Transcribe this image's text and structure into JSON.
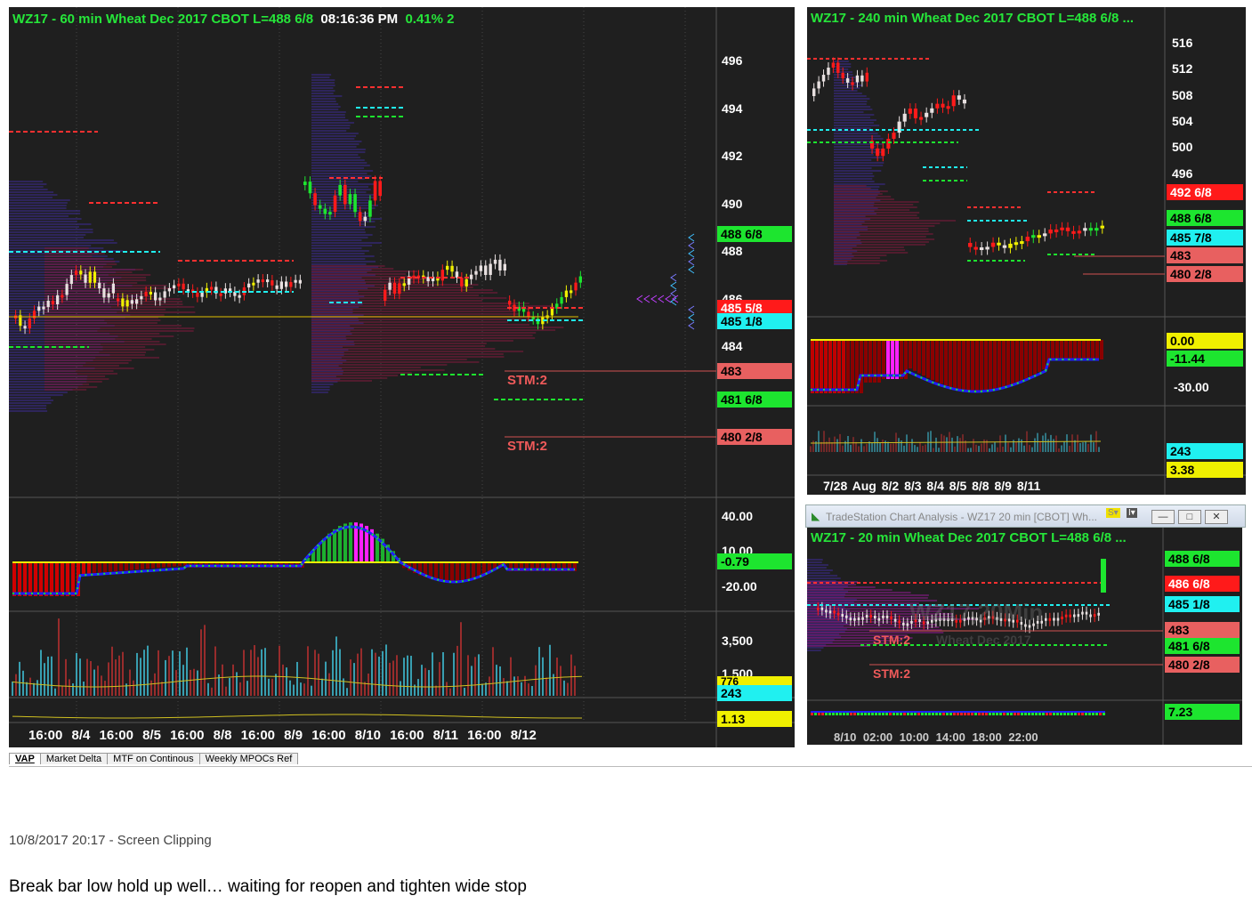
{
  "left": {
    "title": {
      "symbol": "WZ17 - 60 min  Wheat Dec 2017  CBOT  L=488 6/8",
      "time": "08:16:36 PM",
      "tail": "0.41%  2"
    },
    "price_axis": [
      "496",
      "494",
      "492",
      "490",
      "488",
      "486",
      "484"
    ],
    "tags": [
      {
        "text": "488 6/8",
        "color": "#1de52f"
      },
      {
        "text": "485 5/8",
        "color": "#ff1a1a"
      },
      {
        "text": "485 1/8",
        "color": "#20f0f0"
      },
      {
        "text": "483",
        "color": "#e86060"
      },
      {
        "text": "481 6/8",
        "color": "#1de52f"
      },
      {
        "text": "480 2/8",
        "color": "#e86060"
      }
    ],
    "stm1": "STM:2",
    "stm2": "STM:2",
    "osc_axis": [
      "40.00",
      "10.00",
      "-20.00"
    ],
    "osc_tag": "-0.79",
    "vol_axis": [
      "3,500",
      "1,500"
    ],
    "vol_tags": [
      "776",
      "243"
    ],
    "bottom_tag": "1.13",
    "x_labels": "16:00   8/4      16:00   8/5      16:00   8/8      16:00   8/9      16:00   8/10     16:00   8/11     16:00   8/12"
  },
  "right_top": {
    "title": "WZ17 - 240 min  Wheat Dec 2017  CBOT  L=488 6/8  ...",
    "price_axis": [
      "516",
      "512",
      "508",
      "504",
      "500",
      "496"
    ],
    "tags": [
      {
        "text": "492 6/8",
        "color": "#ff1a1a"
      },
      {
        "text": "488 6/8",
        "color": "#1de52f"
      },
      {
        "text": "485 7/8",
        "color": "#20f0f0"
      },
      {
        "text": "483",
        "color": "#e86060"
      },
      {
        "text": "480 2/8",
        "color": "#e86060"
      }
    ],
    "osc_tags": [
      {
        "text": "0.00",
        "color": "#f0f000"
      },
      {
        "text": "-11.44",
        "color": "#1de52f"
      }
    ],
    "osc_axis": "-30.00",
    "vol_tags": [
      {
        "text": "243",
        "color": "#20f0f0"
      },
      {
        "text": "3.38",
        "color": "#f0f000"
      }
    ],
    "x_labels": "7/28     Aug 8/2  8/3  8/4  8/5  8/8  8/9        8/11"
  },
  "right_bottom": {
    "window_title": "TradeStation Chart Analysis - WZ17 20 min [CBOT] Wh...",
    "title": "WZ17 - 20 min  Wheat Dec 2017  CBOT  L=488 6/8  ...",
    "tags": [
      {
        "text": "488 6/8",
        "color": "#1de52f"
      },
      {
        "text": "486 6/8",
        "color": "#ff1a1a"
      },
      {
        "text": "485 1/8",
        "color": "#20f0f0"
      },
      {
        "text": "483",
        "color": "#e86060"
      },
      {
        "text": "481 6/8",
        "color": "#1de52f"
      },
      {
        "text": "480 2/8",
        "color": "#e86060"
      }
    ],
    "stm1": "STM:2",
    "stm2": "STM:2",
    "watermark": "WZ17,20Min",
    "watermark_sub": "Wheat Dec 2017",
    "bottom_tag": "7.23",
    "x_labels": "8/10 02:00  10:00        14:00        18:00        22:00"
  },
  "tabs": [
    "VAP",
    "Market Delta",
    "MTF on Continous",
    "Weekly MPOCs Ref"
  ],
  "clip_caption": "10/8/2017 20:17 - Screen Clipping",
  "note": "Break bar low hold up well… waiting for reopen and tighten wide stop"
}
